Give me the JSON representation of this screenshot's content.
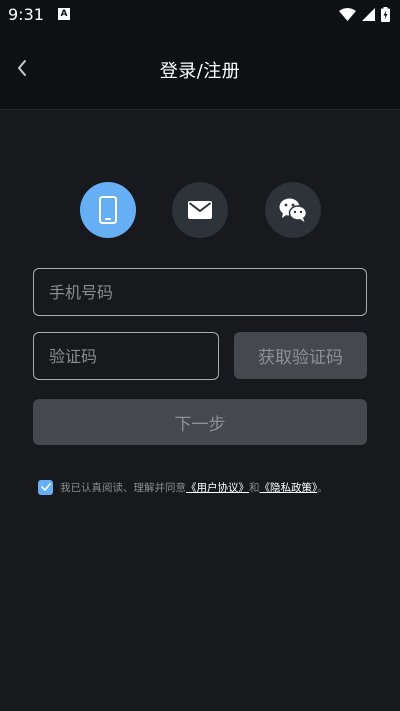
{
  "status_bar": {
    "time": "9:31",
    "notification_icon": "a-icon",
    "wifi_icon": "wifi-icon",
    "signal_icon": "signal-icon",
    "battery_icon": "battery-charging-icon"
  },
  "nav": {
    "back_icon": "chevron-left-icon",
    "title": "登录/注册"
  },
  "methods": [
    {
      "icon": "phone-icon",
      "active": true
    },
    {
      "icon": "mail-icon",
      "active": false
    },
    {
      "icon": "wechat-icon",
      "active": false
    }
  ],
  "form": {
    "phone_placeholder": "手机号码",
    "phone_value": "",
    "code_placeholder": "验证码",
    "code_value": "",
    "get_code_label": "获取验证码",
    "next_label": "下一步"
  },
  "agreement": {
    "checked": true,
    "prefix": "我已认真阅读、理解并同意",
    "user_agreement": "《用户协议》",
    "conjunction": "和",
    "privacy_policy": "《隐私政策》",
    "suffix": "。"
  },
  "colors": {
    "accent": "#66aff5",
    "background": "#17191d",
    "button_disabled": "#45484c"
  }
}
